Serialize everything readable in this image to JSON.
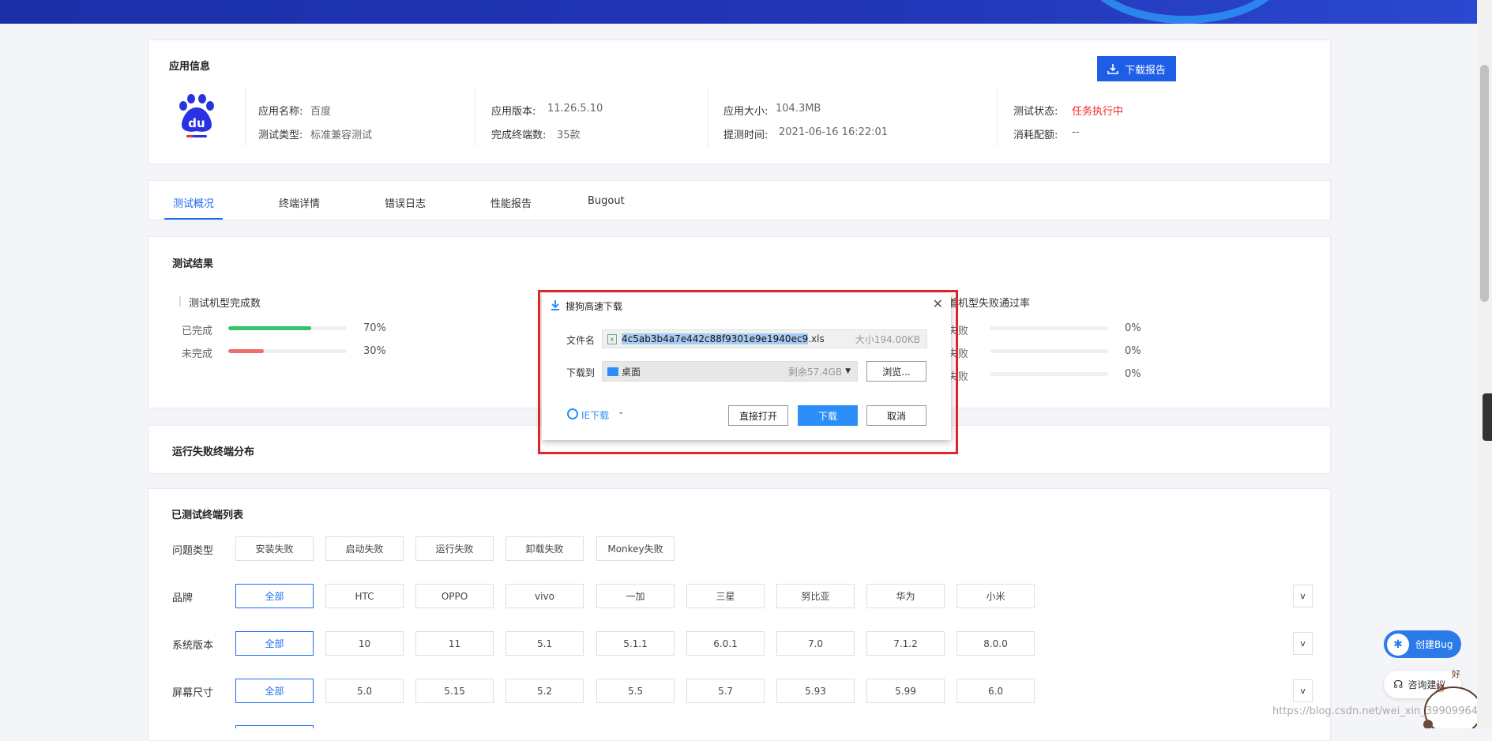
{
  "colors": {
    "primary": "#1e6ff0",
    "success": "#33c36b",
    "danger": "#f5222d",
    "fail_bar": "#f26d6d"
  },
  "app_info": {
    "title": "应用信息",
    "download_report": "下载报告",
    "name_label": "应用名称:",
    "name_value": "百度",
    "type_label": "测试类型:",
    "type_value": "标准兼容测试",
    "version_label": "应用版本:",
    "version_value": "11.26.5.10",
    "devices_label": "完成终端数:",
    "devices_value": "35款",
    "size_label": "应用大小:",
    "size_value": "104.3MB",
    "submit_label": "提测时间:",
    "submit_value": "2021-06-16 16:22:01",
    "status_label": "测试状态:",
    "status_value": "任务执行中",
    "quota_label": "消耗配额:",
    "quota_value": "--"
  },
  "tabs": [
    "测试概况",
    "终端详情",
    "错误日志",
    "性能报告",
    "Bugout"
  ],
  "test_result": {
    "title": "测试结果",
    "completion_title": "测试机型完成数",
    "completion": [
      {
        "label": "已完成",
        "value": 70,
        "text": "70%"
      },
      {
        "label": "未完成",
        "value": 30,
        "text": "30%"
      }
    ],
    "fail_rate_title": "着机型失败通过率",
    "fail_rate": [
      {
        "label": "失败",
        "value": 0,
        "text": "0%"
      },
      {
        "label": "失败",
        "value": 0,
        "text": "0%"
      },
      {
        "label": "失败",
        "value": 0,
        "text": "0%"
      }
    ]
  },
  "distribution": {
    "title": "运行失败终端分布"
  },
  "device_list": {
    "title": "已测试终端列表",
    "problem_label": "问题类型",
    "problems": [
      "安装失败",
      "启动失败",
      "运行失败",
      "卸载失败",
      "Monkey失败"
    ],
    "brand_label": "品牌",
    "brands": [
      "全部",
      "HTC",
      "OPPO",
      "vivo",
      "一加",
      "三星",
      "努比亚",
      "华为",
      "小米"
    ],
    "os_label": "系统版本",
    "os_versions": [
      "全部",
      "10",
      "11",
      "5.1",
      "5.1.1",
      "6.0.1",
      "7.0",
      "7.1.2",
      "8.0.0"
    ],
    "screen_label": "屏幕尺寸",
    "screens": [
      "全部",
      "5.0",
      "5.15",
      "5.2",
      "5.5",
      "5.7",
      "5.93",
      "5.99",
      "6.0"
    ],
    "dropdown": "v"
  },
  "floating": {
    "create_bug": "创建Bug",
    "feedback": "咨询建议"
  },
  "watermark": "https://blog.csdn.net/wei_xin_39909964",
  "dialog": {
    "title": "搜狗高速下载",
    "close": "✕",
    "filename_label": "文件名",
    "filename_selected": "4c5ab3b4a7e442c88f9301e9e1940ec9",
    "filename_ext": ".xls",
    "filesize": "大小194.00KB",
    "saveto_label": "下载到",
    "saveto_value": "桌面",
    "free_space": "剩余57.4GB",
    "browse": "浏览...",
    "ie_download": "IE下载",
    "open_direct": "直接打开",
    "download": "下载",
    "cancel": "取消"
  }
}
